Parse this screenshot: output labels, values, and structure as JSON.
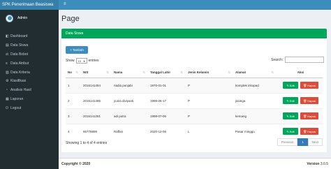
{
  "brand": "SPK Penerimaan Beasiswa",
  "user": {
    "name": "Admin"
  },
  "sidebar": {
    "items": [
      {
        "icon": "dashboard-icon",
        "glyph": "◧",
        "label": "Dashboard"
      },
      {
        "icon": "folder-icon",
        "glyph": "▤",
        "label": "Data Siswa"
      },
      {
        "icon": "scale-icon",
        "glyph": "⚖",
        "label": "Data Bobot"
      },
      {
        "icon": "list-icon",
        "glyph": "≡",
        "label": "Data Atribut"
      },
      {
        "icon": "chart-icon",
        "glyph": "▥",
        "label": "Data Kriteria"
      },
      {
        "icon": "sliders-icon",
        "glyph": "⚙",
        "label": "Klasifikasi"
      },
      {
        "icon": "pie-chart-icon",
        "glyph": "◔",
        "label": "Analisis Hasil"
      },
      {
        "icon": "report-icon",
        "glyph": "▦",
        "label": "Laporan"
      },
      {
        "icon": "logout-icon",
        "glyph": "⏻",
        "label": "Logout"
      }
    ]
  },
  "page": {
    "title": "Page"
  },
  "box": {
    "title": "Data Siswa"
  },
  "toolbar": {
    "add_label": "Tambah"
  },
  "length": {
    "show": "Show",
    "value": "10",
    "entries": "entries"
  },
  "search": {
    "label": "Search:"
  },
  "table": {
    "headers": [
      "No",
      "NIS",
      "Nama",
      "Tanggal Lahir",
      "Jenis Kelamin",
      "Alamat",
      "Aksi"
    ],
    "rows": [
      {
        "no": "1",
        "nis": "2016141484",
        "nama": "nadia punjabi",
        "tgl": "1970-01-01",
        "jk": "P",
        "alamat": "komplek inkopad"
      },
      {
        "no": "2",
        "nis": "2016141485",
        "nama": "yunia diviyanti",
        "tgl": "1998-06-17",
        "jk": "P",
        "alamat": "jasinga"
      },
      {
        "no": "3",
        "nis": "2016141281",
        "nama": "adi putra",
        "tgl": "1998-07-06",
        "jk": "P",
        "alamat": "kemang"
      },
      {
        "no": "4",
        "nis": "66778899",
        "nama": "Raffan",
        "tgl": "2020-12-06",
        "jk": "L",
        "alamat": "Pasar minggu"
      }
    ],
    "edit_label": "Edit",
    "hapus_label": "Hapus"
  },
  "info": "Showing 1 to 4 of 4 entries",
  "pager": {
    "previous": "Previous",
    "current": "1",
    "next": "Next"
  },
  "footer": {
    "copyright": "Copyright © 2020",
    "version_label": "Version",
    "version": "3.0.5"
  },
  "colors": {
    "topbar": "#3c8dbc",
    "sidebar": "#222d32",
    "header_green": "#00a65a",
    "danger": "#dd4b39"
  }
}
